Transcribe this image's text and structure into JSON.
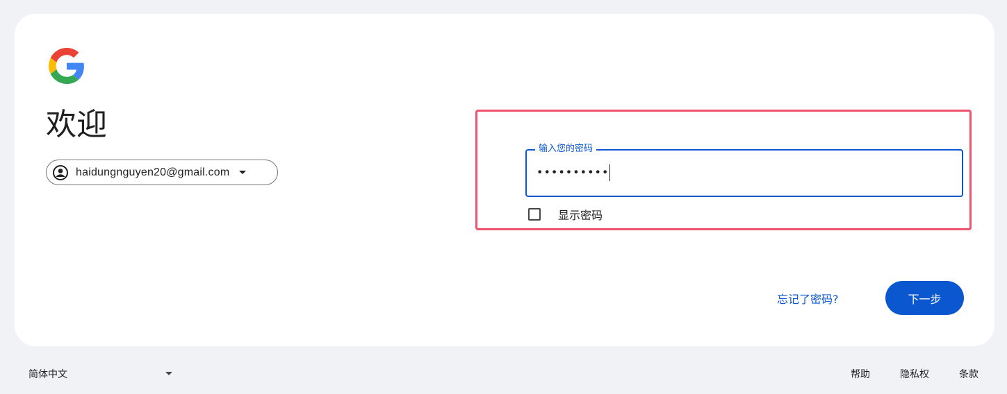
{
  "brand": {
    "logo_icon": "google-g-logo",
    "colors": {
      "blue": "#4285F4",
      "red": "#EA4335",
      "yellow": "#FBBC05",
      "green": "#34A853"
    }
  },
  "main": {
    "heading": "欢迎",
    "account": {
      "email": "haidungnguyen20@gmail.com",
      "avatar_icon": "account-circle-icon",
      "caret_icon": "caret-down-icon"
    },
    "password": {
      "label": "输入您的密码",
      "value": "••••••••••",
      "show_password_label": "显示密码",
      "show_password_checked": false
    },
    "forgot_password": "忘记了密码?",
    "next_button": "下一步",
    "accent_color": "#0b57d0",
    "highlight_color": "#f0526e"
  },
  "footer": {
    "language": "简体中文",
    "links": [
      "帮助",
      "隐私权",
      "条款"
    ]
  }
}
